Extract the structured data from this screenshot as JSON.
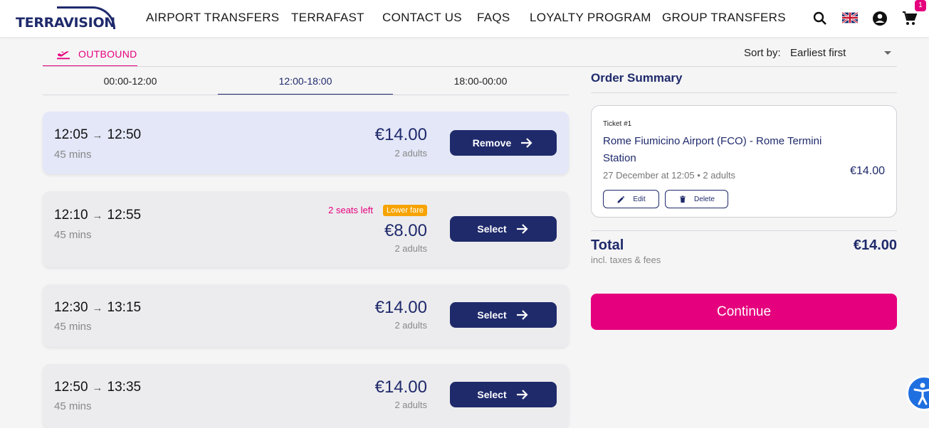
{
  "nav": {
    "logo_text": "TERRAVISION",
    "items": [
      "AIRPORT TRANSFERS",
      "TERRAFAST",
      "CONTACT US",
      "FAQS",
      "LOYALTY PROGRAM",
      "GROUP TRANSFERS"
    ],
    "cart_count": "1"
  },
  "tabs": {
    "outbound": "OUTBOUND"
  },
  "sort": {
    "label": "Sort by:",
    "value": "Earliest first"
  },
  "slots": [
    "00:00-12:00",
    "12:00-18:00",
    "18:00-00:00"
  ],
  "results": [
    {
      "dep": "12:05",
      "arr": "12:50",
      "duration": "45 mins",
      "price": "€14.00",
      "pax": "2 adults",
      "button": "Remove"
    },
    {
      "dep": "12:10",
      "arr": "12:55",
      "duration": "45 mins",
      "price": "€8.00",
      "pax": "2 adults",
      "button": "Select",
      "seats": "2 seats left",
      "badge": "Lower fare"
    },
    {
      "dep": "12:30",
      "arr": "13:15",
      "duration": "45 mins",
      "price": "€14.00",
      "pax": "2 adults",
      "button": "Select"
    },
    {
      "dep": "12:50",
      "arr": "13:35",
      "duration": "45 mins",
      "price": "€14.00",
      "pax": "2 adults",
      "button": "Select"
    }
  ],
  "summary": {
    "title": "Order Summary",
    "ticket_num": "Ticket #1",
    "route": "Rome Fiumicino Airport (FCO) - Rome Termini Station",
    "date": "27 December at 12:05 • 2 adults",
    "price": "€14.00",
    "edit": "Edit",
    "delete": "Delete",
    "total_label": "Total",
    "total_value": "€14.00",
    "incl": "incl. taxes & fees",
    "continue": "Continue"
  },
  "colors": {
    "brand_navy": "#1f2a6b",
    "brand_pink": "#e5007d",
    "badge_orange": "#f7a300"
  }
}
